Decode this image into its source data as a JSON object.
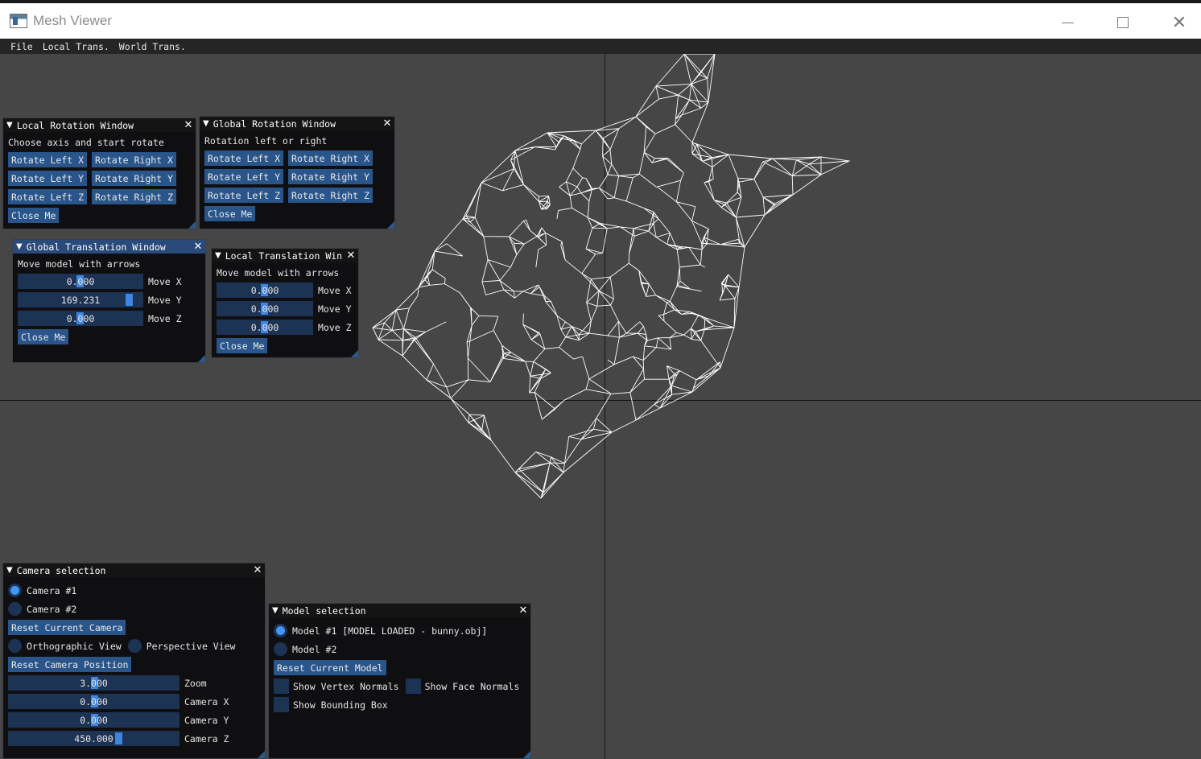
{
  "window": {
    "title": "Mesh Viewer"
  },
  "menu": {
    "items": [
      "File",
      "Local Trans.",
      "World Trans."
    ]
  },
  "local_rotation": {
    "title": "Local Rotation Window",
    "hint": "Choose axis and start rotate",
    "buttons": {
      "left_x": "Rotate Left X",
      "right_x": "Rotate Right X",
      "left_y": "Rotate Left Y",
      "right_y": "Rotate Right Y",
      "left_z": "Rotate Left Z",
      "right_z": "Rotate Right Z"
    },
    "close": "Close Me"
  },
  "global_rotation": {
    "title": "Global Rotation Window",
    "hint": "Rotation left or right",
    "buttons": {
      "left_x": "Rotate Left X",
      "right_x": "Rotate Right X",
      "left_y": "Rotate Left Y",
      "right_y": "Rotate Right Y",
      "left_z": "Rotate Left Z",
      "right_z": "Rotate Right Z"
    },
    "close": "Close Me"
  },
  "global_translation": {
    "title": "Global Translation Window",
    "hint": "Move model with arrows",
    "x": {
      "value": "0.000",
      "label": "Move X"
    },
    "y": {
      "value": "169.231",
      "label": "Move Y"
    },
    "z": {
      "value": "0.000",
      "label": "Move Z"
    },
    "close": "Close Me"
  },
  "local_translation": {
    "title": "Local Translation Win",
    "hint": "Move model with arrows",
    "x": {
      "value": "0.000",
      "label": "Move X"
    },
    "y": {
      "value": "0.000",
      "label": "Move Y"
    },
    "z": {
      "value": "0.000",
      "label": "Move Z"
    },
    "close": "Close Me"
  },
  "camera_selection": {
    "title": "Camera selection",
    "camera1": "Camera #1",
    "camera2": "Camera #2",
    "selected_camera": 1,
    "reset_camera": "Reset Current Camera",
    "ortho": "Orthographic View",
    "persp": "Perspective View",
    "reset_position": "Reset Camera Position",
    "zoom": {
      "value": "3.000",
      "label": "Zoom"
    },
    "cam_x": {
      "value": "0.000",
      "label": "Camera X"
    },
    "cam_y": {
      "value": "0.000",
      "label": "Camera Y"
    },
    "cam_z": {
      "value": "450.000",
      "label": "Camera Z"
    }
  },
  "model_selection": {
    "title": "Model selection",
    "model1": "Model #1 [MODEL LOADED - bunny.obj]",
    "model2": "Model #2",
    "selected_model": 1,
    "reset_model": "Reset Current Model",
    "vertex_normals": "Show Vertex Normals",
    "face_normals": "Show Face Normals",
    "bounding_box": "Show Bounding Box",
    "vertex_normals_checked": false,
    "face_normals_checked": false,
    "bounding_box_checked": false
  },
  "colors": {
    "background": "#464646",
    "button": "#29558a",
    "slider_grab": "#3d85e0",
    "title_active": "#294a7a",
    "mesh": "#ffffff"
  }
}
